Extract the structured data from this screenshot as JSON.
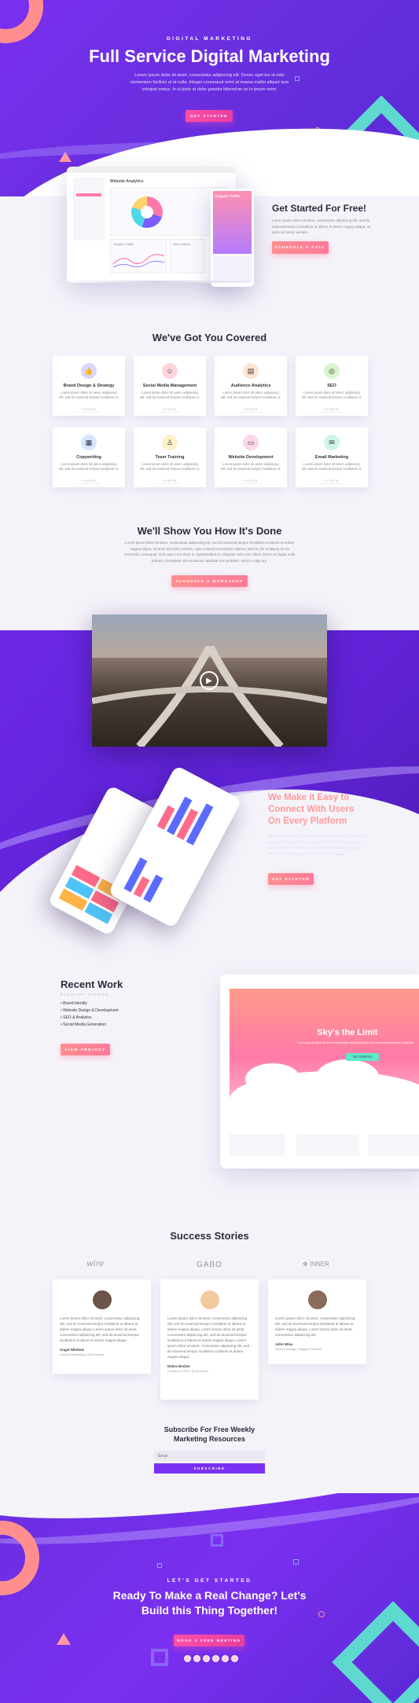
{
  "hero": {
    "kicker": "DIGITAL MARKETING",
    "title": "Full Service Digital Marketing",
    "desc_line1": "Lorem ipsum dolor sit amet, consectetur adipiscing elit. Donec eget leo ut odio",
    "desc_line2": "elementum facilisis ut at nulla. Integer consequat enim at massa mattis aliquet quis",
    "desc_line3": "volutpat metus. In ut justo at dolor gravida bibendum ac in ipsum enim.",
    "cta": "GET STARTED"
  },
  "dashboard": {
    "title": "Website Analytics",
    "pie_colors": [
      "#ff7aa8",
      "#7b5cff",
      "#4fd8e8",
      "#ffd36b"
    ],
    "panel1": "Organic Traffic",
    "panel2": "New Visitors",
    "phone_title": "Organic Traffic"
  },
  "free": {
    "title": "Get Started For Free!",
    "desc": "Lorem ipsum dolor sit amet, consectetur adipiscing elit, sed do eiusmod tempor incididunt ut labore et dolore magna aliqua. Ut enim ad minim veniam.",
    "cta": "SCHEDULE A CALL"
  },
  "covered": {
    "title": "We've Got You Covered",
    "items": [
      {
        "title": "Brand Design & Strategy",
        "icon": "thumbs-up-icon",
        "color": "#dcd6ff",
        "glyph": "👍"
      },
      {
        "title": "Social Media Management",
        "icon": "people-icon",
        "color": "#ffd6dc",
        "glyph": "☺"
      },
      {
        "title": "Audience Analytics",
        "icon": "chart-icon",
        "color": "#ffe4cf",
        "glyph": "▤"
      },
      {
        "title": "SEO",
        "icon": "target-icon",
        "color": "#d8f5d0",
        "glyph": "◎"
      },
      {
        "title": "Copywriting",
        "icon": "document-icon",
        "color": "#d6e4ff",
        "glyph": "▦"
      },
      {
        "title": "Team Training",
        "icon": "person-icon",
        "color": "#fff0c8",
        "glyph": "♙"
      },
      {
        "title": "Website Development",
        "icon": "monitor-icon",
        "color": "#ffd6ec",
        "glyph": "▭"
      },
      {
        "title": "Email Marketing",
        "icon": "mail-icon",
        "color": "#cff5ea",
        "glyph": "✉"
      }
    ],
    "item_desc": "Lorem ipsum dolor sit amet, adipiscing elit, sed do eiusmod tempor incididunt ut.",
    "learn": "LEARN"
  },
  "show": {
    "title": "We'll Show You How It's Done",
    "desc": "Lorem ipsum dolor sit amet, consectetur adipiscing elit, sed do eiusmod tempor incididunt ut labore et dolore magna aliqua. Ut enim ad minim veniam, quis nostrud exercitation ullamco laboris nisi ut aliquip ex ea commodo consequat. Duis aute irure dolor in reprehenderit in voluptate velit esse cillum dolore eu fugiat nulla pariatur. Excepteur sint occaecat cupidatat non proident, sunt in culpa qui.",
    "cta": "SCHEDULE A WORKSHOP"
  },
  "platform": {
    "title_line1": "We Make it Easy to",
    "title_line2": "Connect With Users",
    "title_line3": "On Every Platform",
    "desc": "Lorem ipsum dolor sit amet, consectetur adipiscing elit, sed do eiusmod tempor incididunt ut labore et dolore magna aliqua. Ut enim ad minim veniam, quis nostrud exercitation ullamco laboris nisi ut aliquip ex ea commodo consequat.",
    "cta": "GET STARTED"
  },
  "recent": {
    "title": "Recent Work",
    "subtitle": "ELEGANT THEMES",
    "bullets": [
      "Brand Identity",
      "Website Design & Development",
      "SEO & Analytics",
      "Social Media Generation"
    ],
    "cta": "VIEW PROJECT",
    "laptop_title": "Sky's the Limit",
    "laptop_desc": "Lorem ipsum dolor sit amet consectetur adipiscing elit sed do eiusmod tempor incididunt",
    "laptop_btn": "GET STARTED"
  },
  "stories": {
    "title": "Success Stories",
    "logos": [
      "wire",
      "GABO",
      "INNER"
    ],
    "cards": [
      {
        "text": "Lorem ipsum dolor sit amet, consectetur adipiscing elit, sed do eiusmod tempor incididunt ut labore et dolore magna aliqua. Lorem ipsum dolor sit amet, consectetur adipiscing elit, sed do eiusmod tempor incididunt ut labore et dolore magna aliqua.",
        "name": "Angel Whitlow",
        "role": "Head of Marketing, Dirt's Space"
      },
      {
        "text": "Lorem ipsum dolor sit amet, consectetur adipiscing elit, sed do eiusmod tempor incididunt ut labore et dolore magna aliqua. Lorem ipsum dolor sit amet, consectetur adipiscing elit, sed do eiusmod tempor incididunt ut labore et dolore magna aliqua. Lorem ipsum dolor sit amet, consectetur adipiscing elit, sed do eiusmod tempor incididunt ut labore et dolore magna aliqua.",
        "name": "Debra Becker",
        "role": "Founder & CEO, Shut Center"
      },
      {
        "text": "Lorem ipsum dolor sit amet, consectetur adipiscing elit, sed do eiusmod tempor incididunt ut labore et dolore magna aliqua. Lorem ipsum dolor sit amet, consectetur adipiscing elit.",
        "name": "John Wise",
        "role": "Head of Design, Ragged Themes"
      }
    ]
  },
  "subscribe": {
    "title_line1": "Subscribe For Free Weekly",
    "title_line2": "Marketing Resources",
    "placeholder": "Email",
    "button": "SUBSCRIBE"
  },
  "footer_cta": {
    "kicker": "LET'S GET STARTED",
    "title_line1": "Ready To Make a Real Change? Let's",
    "title_line2": "Build this Thing Together!",
    "cta": "BOOK A FREE MEETING"
  },
  "colors": {
    "accent": "#ff4fa6",
    "purple": "#6a2fe0",
    "coral": "#ff8f8f"
  }
}
